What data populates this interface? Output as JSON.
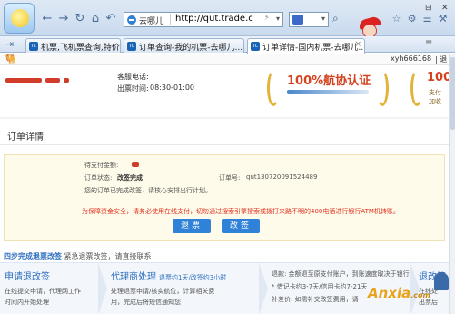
{
  "browser": {
    "address": {
      "mode": "去哪儿",
      "url": "http://qut.trade.c",
      "dropdown_icon": "▾"
    },
    "search": {
      "dropdown_icon": "▾"
    },
    "nav_icons": [
      "back-icon",
      "forward-icon",
      "reload-icon",
      "stop-icon",
      "undo-icon"
    ],
    "tabs": [
      {
        "label": "机票,飞机票查询,特价机票..."
      },
      {
        "label": "订单查询-我的机票-去哪儿..."
      },
      {
        "label": "订单详情-国内机票-去哪儿..."
      }
    ],
    "tab_list_icon": "≡",
    "window_buttons": [
      "⊟",
      "✕"
    ]
  },
  "page": {
    "top": {
      "username": "xyh666168",
      "separator": "| 退"
    },
    "header": {
      "phone_label": "客服电话:",
      "hours_label": "出票时间:",
      "hours_value": "08:30-01:00",
      "badge1_title": "100%航协认证",
      "badge2_title": "100",
      "badge2_sub1": "支付",
      "badge2_sub2": "加收"
    },
    "title": "订单详情",
    "info": {
      "amount_label": "待支付金额:",
      "status_label": "订单状态:",
      "status_value": "改签完成",
      "order_label": "订单号:",
      "order_value": "qut130720091524489",
      "message": "您的订单已完成改签，请核心安排出行计划。",
      "warning": "为保障资金安全，请务必使用在线支付，切勿通过搜索引擎搜索或拨打来路不明的400电话进行银行ATM机转账。",
      "refund_btn": "退票",
      "change_btn": "改签"
    },
    "steps_title": {
      "main": "四步完成退票改签",
      "sub": "紧急退票改签，请直接联系"
    },
    "steps": [
      {
        "head": "申请退改签",
        "note": "",
        "lines": [
          "在线提交申请，代理网工作",
          "时间内开始处理"
        ]
      },
      {
        "head": "代理商处理",
        "note": "退票约1天/改签约3小时",
        "lines": [
          "处理退票申请/核实航位，计算相关费",
          "用，完成后将短信通知您"
        ]
      },
      {
        "head": "",
        "note": "",
        "lines": [
          "退款: 金额退至原支付账户，到账速度取决于银行",
          "* 借记卡约3-7天/信用卡约7-21天",
          "补差价: 如需补交改签费用，请"
        ]
      },
      {
        "head": "退改签",
        "note": "",
        "lines": [
          "在线处",
          "出票后"
        ]
      }
    ]
  },
  "watermark": {
    "main": "Anxia",
    "suffix": ".com"
  },
  "colors": {
    "accent": "#2f82d8",
    "warning": "#e0301e",
    "badge": "#d4421f"
  }
}
